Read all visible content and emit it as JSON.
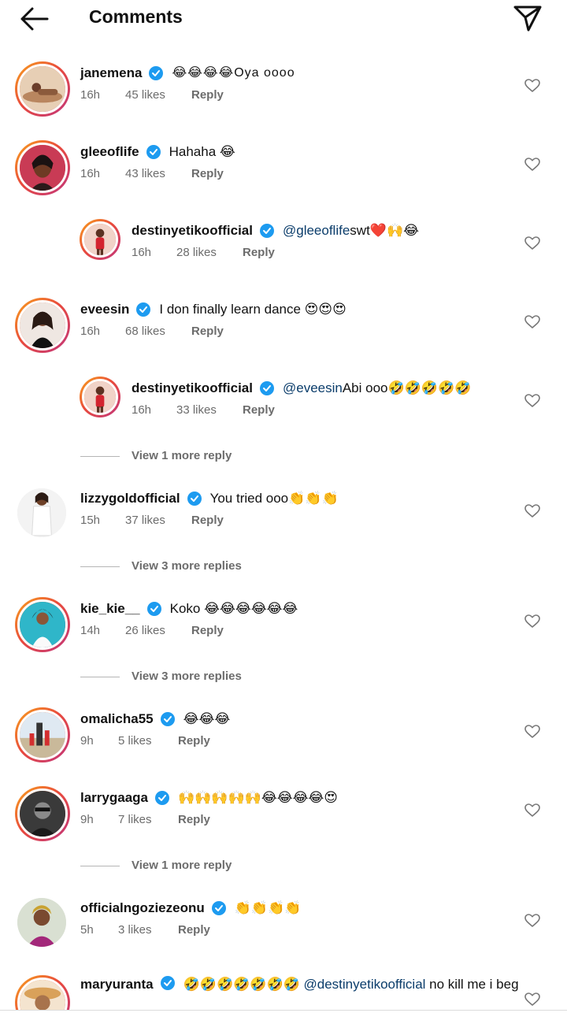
{
  "header": {
    "title": "Comments",
    "back_icon": "arrow-left-icon",
    "send_icon": "paper-plane-icon"
  },
  "colors": {
    "ring_start": "#f9a61b",
    "ring_mid": "#e94b3c",
    "ring_end": "#c1357d",
    "verified": "#1d9bf0",
    "mention": "#0b3d6b",
    "meta": "#6c6c6c"
  },
  "comments": [
    {
      "username": "janemena",
      "text": "😂😂😂😂Oya oooo",
      "mention": "",
      "time": "16h",
      "likes": "45 likes",
      "reply": "Reply"
    },
    {
      "username": "gleeoflife",
      "text": "Hahaha 😂",
      "mention": "",
      "time": "16h",
      "likes": "43 likes",
      "reply": "Reply"
    },
    {
      "username": "destinyetikoofficial",
      "mention": "@gleeoflife",
      "text": " swt❤️🙌😂",
      "time": "16h",
      "likes": "28 likes",
      "reply": "Reply"
    },
    {
      "username": "eveesin",
      "text": "I don finally learn dance 😍😍😍",
      "mention": "",
      "time": "16h",
      "likes": "68 likes",
      "reply": "Reply"
    },
    {
      "username": "destinyetikoofficial",
      "mention": "@eveesin",
      "text": " Abi ooo🤣🤣🤣🤣🤣",
      "time": "16h",
      "likes": "33 likes",
      "reply": "Reply"
    },
    {
      "username": "lizzygoldofficial",
      "text": "You tried ooo👏👏👏",
      "mention": "",
      "time": "15h",
      "likes": "37 likes",
      "reply": "Reply"
    },
    {
      "username": "kie_kie__",
      "text": "Koko 😂😂😂😂😂😂",
      "mention": "",
      "time": "14h",
      "likes": "26 likes",
      "reply": "Reply"
    },
    {
      "username": "omalicha55",
      "text": "😂😂😂",
      "mention": "",
      "time": "9h",
      "likes": "5 likes",
      "reply": "Reply"
    },
    {
      "username": "larrygaaga",
      "text": "🙌🙌🙌🙌🙌😂😂😂😂😍",
      "mention": "",
      "time": "9h",
      "likes": "7 likes",
      "reply": "Reply"
    },
    {
      "username": "officialngoziezeonu",
      "text": "👏👏👏👏",
      "mention": "",
      "time": "5h",
      "likes": "3 likes",
      "reply": "Reply"
    },
    {
      "username": "maryuranta",
      "text_before": "🤣🤣🤣🤣🤣🤣🤣",
      "mention": "@destinyetikoofficial",
      "text": " no kill me i beg"
    }
  ],
  "view_more": [
    {
      "label": "View 1 more reply"
    },
    {
      "label": "View 3 more replies"
    },
    {
      "label": "View 3 more replies"
    },
    {
      "label": "View 1 more reply"
    }
  ]
}
